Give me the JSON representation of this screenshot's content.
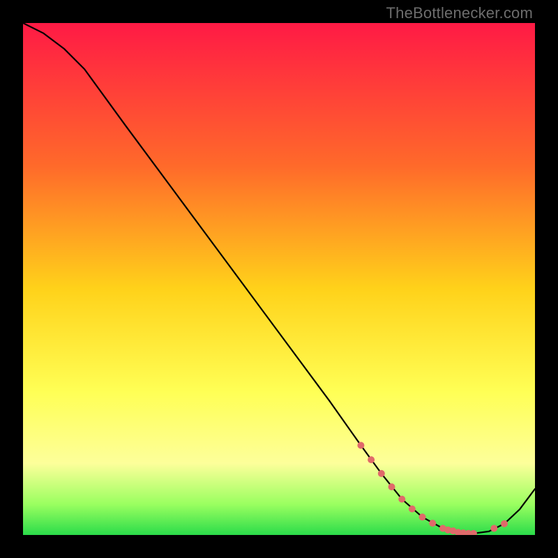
{
  "watermark": "TheBottlenecker.com",
  "colors": {
    "gradient_top": "#ff1a45",
    "gradient_mid1": "#ff6a2a",
    "gradient_mid2": "#ffd21a",
    "gradient_mid3": "#ffff55",
    "gradient_light": "#fdff9a",
    "gradient_green_light": "#9aff60",
    "gradient_green": "#2bdc4a",
    "black": "#000000",
    "line": "#000000",
    "marker": "#e06a6a"
  },
  "chart_data": {
    "type": "line",
    "title": "",
    "xlabel": "",
    "ylabel": "",
    "xlim": [
      0,
      100
    ],
    "ylim": [
      0,
      100
    ],
    "series": [
      {
        "name": "curve",
        "x": [
          0,
          4,
          8,
          12,
          20,
          30,
          40,
          50,
          60,
          66,
          70,
          74,
          78,
          82,
          85,
          88,
          91,
          94,
          97,
          100
        ],
        "y": [
          100,
          98,
          95,
          91,
          80,
          66.5,
          53,
          39.5,
          26,
          17.5,
          12,
          7,
          3.5,
          1.3,
          0.5,
          0.3,
          0.7,
          2.2,
          5.0,
          9.0
        ]
      }
    ],
    "markers": {
      "name": "highlight-dots",
      "x": [
        66,
        68,
        70,
        72,
        74,
        76,
        78,
        80,
        82,
        83,
        84,
        85,
        86,
        87,
        88,
        92,
        94
      ],
      "y": [
        17.5,
        14.7,
        12.0,
        9.4,
        7.0,
        5.1,
        3.5,
        2.3,
        1.3,
        1.0,
        0.8,
        0.5,
        0.4,
        0.3,
        0.3,
        1.3,
        2.2
      ]
    }
  }
}
